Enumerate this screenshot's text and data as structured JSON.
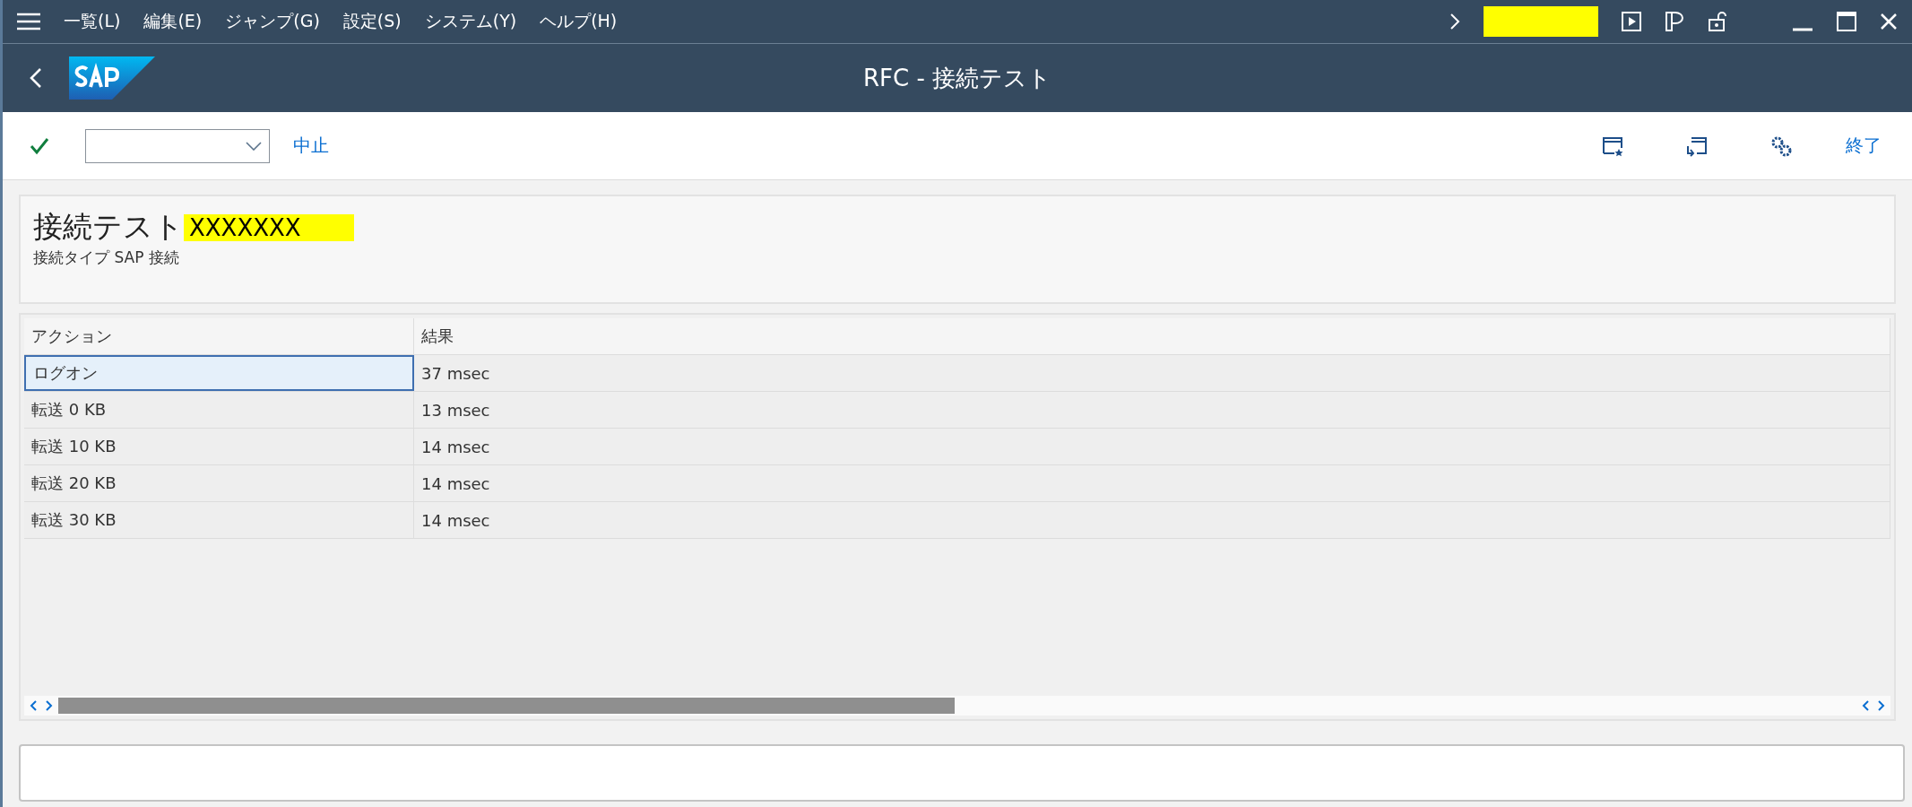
{
  "menu": [
    "一覧(L)",
    "編集(E)",
    "ジャンプ(G)",
    "設定(S)",
    "システム(Y)",
    "ヘルプ(H)"
  ],
  "title": "RFC - 接続テスト",
  "toolbar": {
    "cancel": "中止",
    "exit": "終了"
  },
  "header": {
    "title": "接続テスト",
    "redacted_name": "XXXXXXX",
    "subtitle": "接続タイプ SAP 接続"
  },
  "table": {
    "columns": [
      "アクション",
      "結果"
    ],
    "rows": [
      {
        "action": "ログオン",
        "result": "37 msec",
        "selected": true
      },
      {
        "action": "転送 0 KB",
        "result": "13 msec",
        "selected": false
      },
      {
        "action": "転送 10 KB",
        "result": "14 msec",
        "selected": false
      },
      {
        "action": "転送 20 KB",
        "result": "14 msec",
        "selected": false
      },
      {
        "action": "転送 30 KB",
        "result": "14 msec",
        "selected": false
      }
    ]
  }
}
